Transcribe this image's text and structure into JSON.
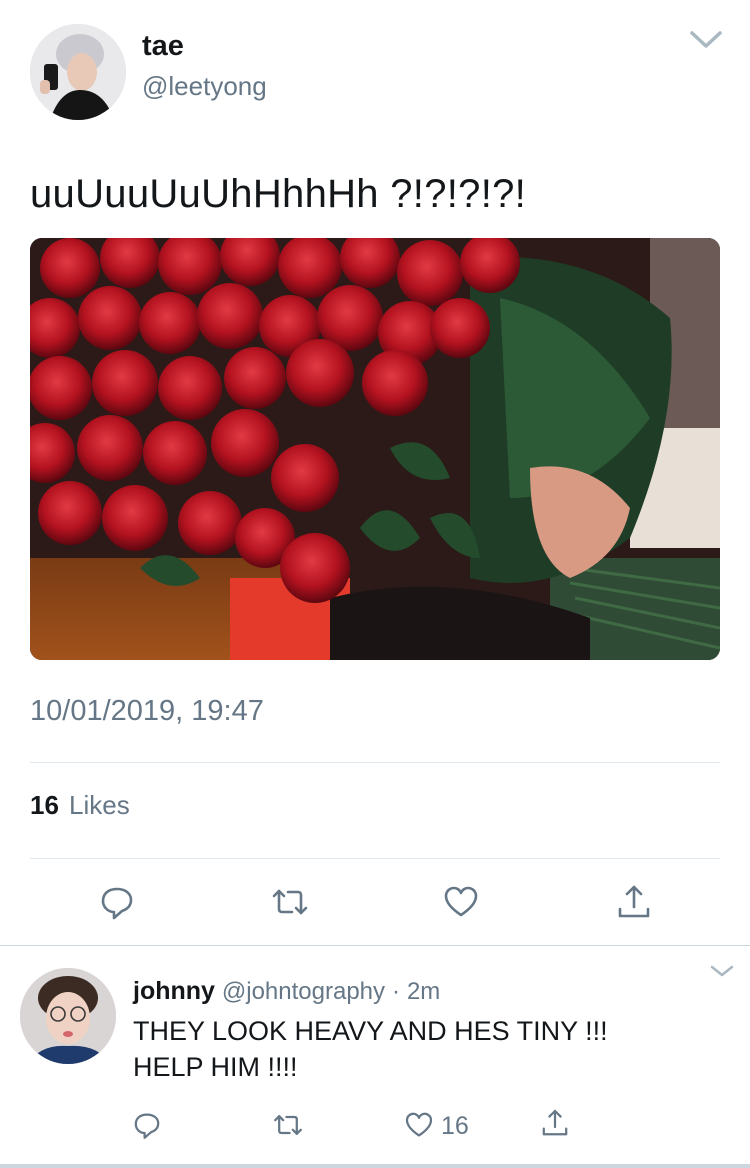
{
  "tweet": {
    "display_name": "tae",
    "handle": "@leetyong",
    "text": "uuUuuUuUhHhhHh ?!?!?!?!",
    "timestamp": "10/01/2019, 19:47",
    "likes_count": "16",
    "likes_label": "Likes"
  },
  "reply": {
    "display_name": "johnny",
    "handle": "@johntography",
    "separator": "·",
    "time": "2m",
    "text_line1": "THEY LOOK HEAVY AND HES TINY !!!",
    "text_line2": "HELP HIM !!!!",
    "like_count": "16"
  },
  "icons": {
    "reply": "reply-icon",
    "retweet": "retweet-icon",
    "like": "heart-icon",
    "share": "share-icon",
    "menu": "chevron-down-icon"
  },
  "colors": {
    "text": "#14171a",
    "secondary": "#657786",
    "divider": "#e1e8ed",
    "icon": "#657786",
    "rose": "#b3121f"
  }
}
